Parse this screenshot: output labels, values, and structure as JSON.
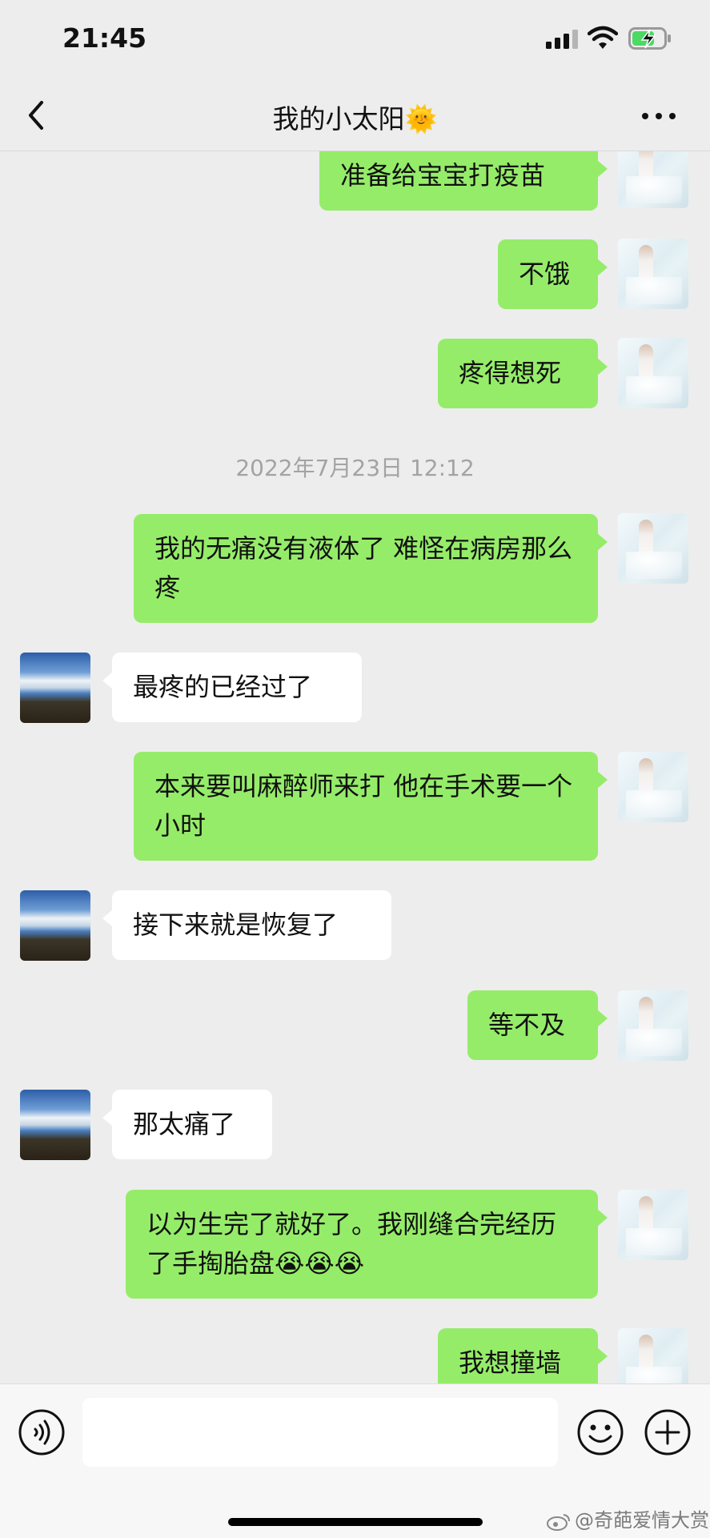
{
  "status_bar": {
    "time": "21:45"
  },
  "nav": {
    "title": "我的小太阳🌞"
  },
  "timestamp": "2022年7月23日 12:12",
  "messages": [
    {
      "text": "准备给宝宝打疫苗"
    },
    {
      "text": "不饿"
    },
    {
      "text": "疼得想死"
    },
    {
      "text": "我的无痛没有液体了 难怪在病房那么疼"
    },
    {
      "text": "最疼的已经过了"
    },
    {
      "text": "本来要叫麻醉师来打 他在手术要一个小时"
    },
    {
      "text": "接下来就是恢复了"
    },
    {
      "text": "等不及"
    },
    {
      "text": "那太痛了"
    },
    {
      "text": "以为生完了就好了。我刚缝合完经历了手掏胎盘😭😭😭"
    },
    {
      "text": "我想撞墙"
    }
  ],
  "input": {
    "value": ""
  },
  "watermark": "@奇葩爱情大赏",
  "colors": {
    "bubble_right": "#95ec69",
    "bubble_left": "#ffffff",
    "background": "#ededed"
  }
}
